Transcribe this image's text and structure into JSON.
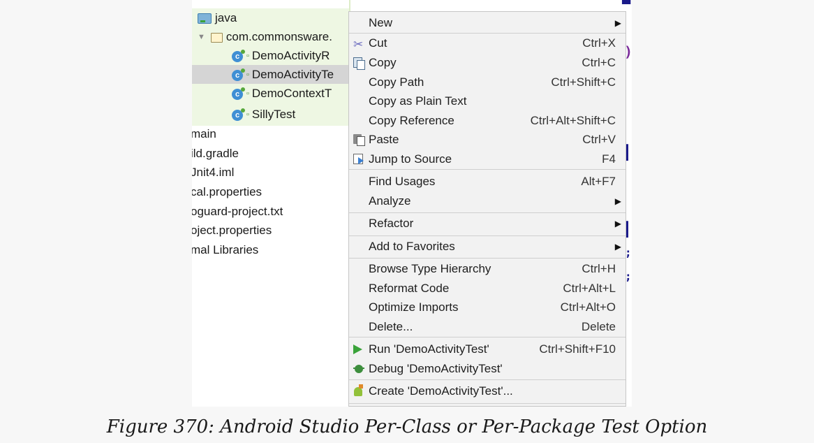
{
  "tree": {
    "items": [
      {
        "label": "java",
        "kind": "source-folder"
      },
      {
        "label": "com.commonsware.",
        "kind": "package"
      },
      {
        "label": "DemoActivityR",
        "kind": "test-class"
      },
      {
        "label": "DemoActivityTe",
        "kind": "test-class",
        "selected": true
      },
      {
        "label": "DemoContextT",
        "kind": "test-class"
      },
      {
        "label": "SillyTest",
        "kind": "test-class"
      },
      {
        "label": "main",
        "kind": "folder"
      },
      {
        "label": "ild.gradle",
        "kind": "file"
      },
      {
        "label": "Jnit4.iml",
        "kind": "file"
      },
      {
        "label": "cal.properties",
        "kind": "file"
      },
      {
        "label": "oguard-project.txt",
        "kind": "file"
      },
      {
        "label": "oject.properties",
        "kind": "file"
      },
      {
        "label": "mal Libraries",
        "kind": "file"
      }
    ]
  },
  "menu": {
    "items": [
      {
        "label": "New",
        "submenu": true
      },
      {
        "label": "Cut",
        "shortcut": "Ctrl+X",
        "icon": "cut-icon"
      },
      {
        "label": "Copy",
        "shortcut": "Ctrl+C",
        "icon": "copy-icon"
      },
      {
        "label": "Copy Path",
        "shortcut": "Ctrl+Shift+C"
      },
      {
        "label": "Copy as Plain Text"
      },
      {
        "label": "Copy Reference",
        "shortcut": "Ctrl+Alt+Shift+C"
      },
      {
        "label": "Paste",
        "shortcut": "Ctrl+V",
        "icon": "paste-icon"
      },
      {
        "label": "Jump to Source",
        "shortcut": "F4",
        "icon": "jump-to-source-icon"
      },
      {
        "label": "Find Usages",
        "shortcut": "Alt+F7"
      },
      {
        "label": "Analyze",
        "submenu": true
      },
      {
        "label": "Refactor",
        "submenu": true
      },
      {
        "label": "Add to Favorites",
        "submenu": true
      },
      {
        "label": "Browse Type Hierarchy",
        "shortcut": "Ctrl+H"
      },
      {
        "label": "Reformat Code",
        "shortcut": "Ctrl+Alt+L"
      },
      {
        "label": "Optimize Imports",
        "shortcut": "Ctrl+Alt+O"
      },
      {
        "label": "Delete...",
        "shortcut": "Delete"
      },
      {
        "label": "Run 'DemoActivityTest'",
        "shortcut": "Ctrl+Shift+F10",
        "icon": "run-icon"
      },
      {
        "label": "Debug 'DemoActivityTest'",
        "icon": "debug-icon"
      },
      {
        "label": "Create 'DemoActivityTest'...",
        "icon": "android-icon"
      }
    ]
  },
  "caption": "Figure 370: Android Studio Per-Class or Per-Package Test Option",
  "colors": {
    "tree_highlight": "#eef7e3",
    "selected_row": "#d5d5d5",
    "menu_bg": "#f2f2f2",
    "run_green": "#3aa33a"
  }
}
